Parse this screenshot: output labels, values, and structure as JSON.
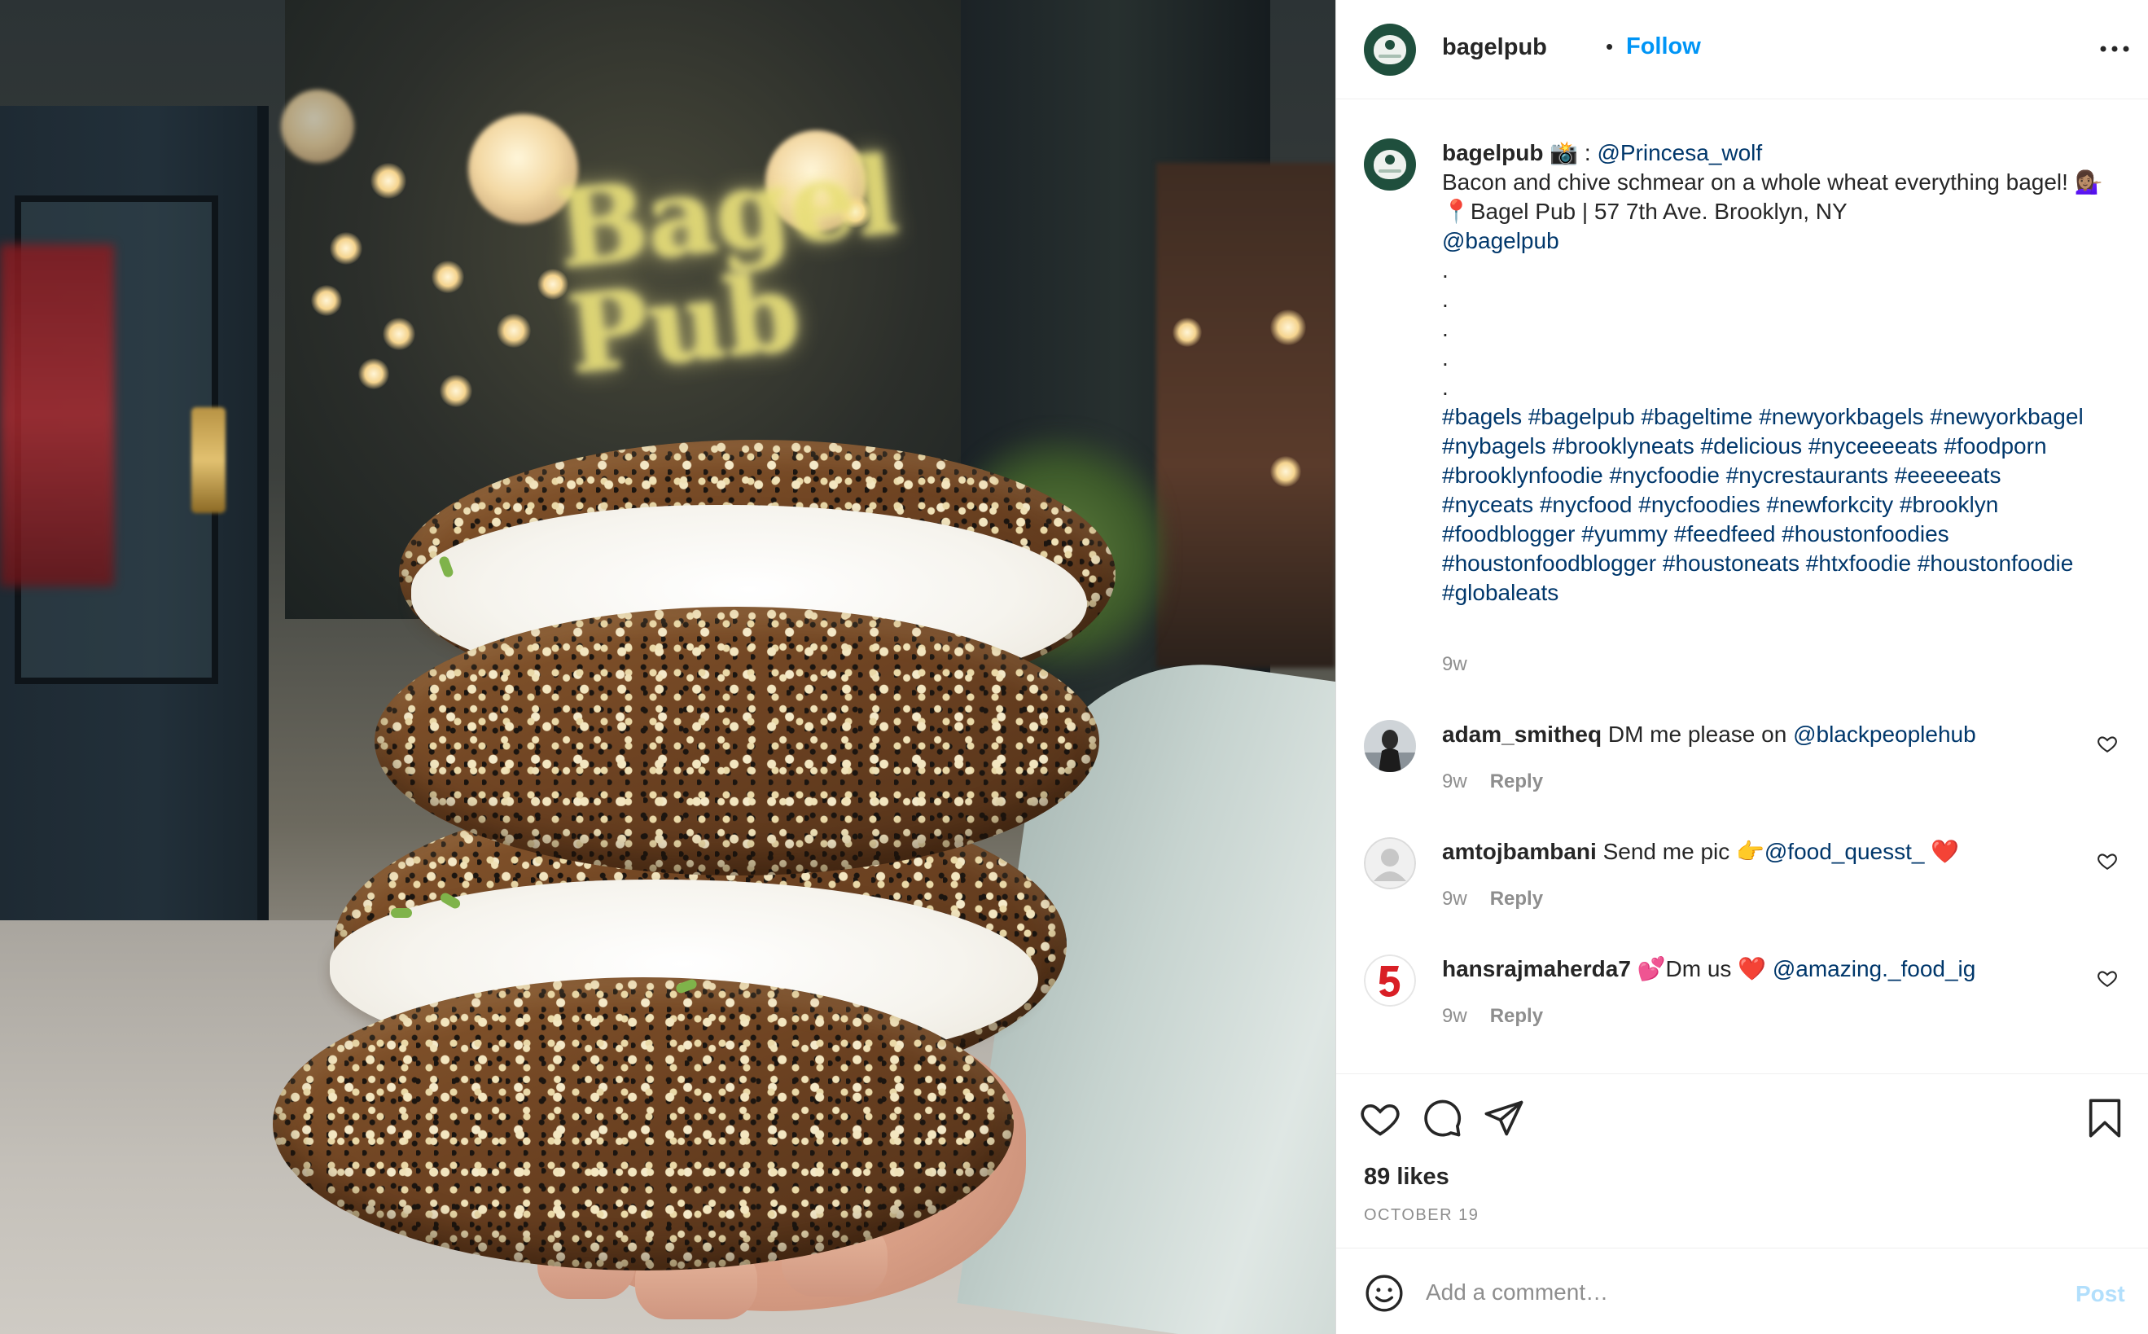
{
  "header": {
    "username": "bagelpub",
    "separator": "•",
    "follow_label": "Follow",
    "more_icon": "more-options-icon"
  },
  "caption": {
    "username": "bagelpub",
    "camera_emoji": "📸",
    "colon": " : ",
    "credit": "@Princesa_wolf",
    "line1": "Bacon and chive schmear on a whole wheat everything bagel! 💁🏽‍♀️",
    "pin_emoji": "📍",
    "location": "Bagel Pub | 57 7th Ave. Brooklyn, NY",
    "mention": "@bagelpub",
    "dots": [
      ".",
      ".",
      ".",
      ".",
      "."
    ],
    "hashtags": [
      "#bagels #bagelpub #bageltime #newyorkbagels #newyorkbagel",
      "#nybagels #brooklyneats #delicious #nyceeeeats #foodporn",
      "#brooklynfoodie #nycfoodie #nycrestaurants #eeeeeats",
      "#nyceats #nycfood #nycfoodies #newforkcity #brooklyn",
      "#foodblogger #yummy #feedfeed #houstonfoodies",
      "#houstonfoodblogger #houstoneats #htxfoodie #houstonfoodie",
      "#globaleats"
    ],
    "time": "9w"
  },
  "comments": [
    {
      "username": "adam_smitheq",
      "text": " DM me please on ",
      "link": "@blackpeoplehub",
      "tail": "",
      "time": "9w",
      "reply": "Reply"
    },
    {
      "username": "amtojbambani",
      "text": " Send me pic 👉",
      "link": "@food_quesst_",
      "tail": " ❤️",
      "time": "9w",
      "reply": "Reply"
    },
    {
      "username": "hansrajmaherda7",
      "text": " 💕Dm us ❤️ ",
      "link": "@amazing._food_ig",
      "tail": "",
      "time": "9w",
      "reply": "Reply"
    }
  ],
  "actions": {
    "like_icon": "heart-icon",
    "comment_icon": "comment-icon",
    "share_icon": "paper-plane-icon",
    "save_icon": "bookmark-icon",
    "likes": "89 likes",
    "date": "OCTOBER 19"
  },
  "add_comment": {
    "placeholder": "Add a comment…",
    "post_label": "Post"
  },
  "photo": {
    "sign_text": "Bagel Pub"
  },
  "colors": {
    "accent": "#0095f6",
    "link": "#00376b",
    "muted": "#8e8e8e",
    "avatar_green": "#1f4f3d",
    "post_disabled": "#b2dffc"
  }
}
